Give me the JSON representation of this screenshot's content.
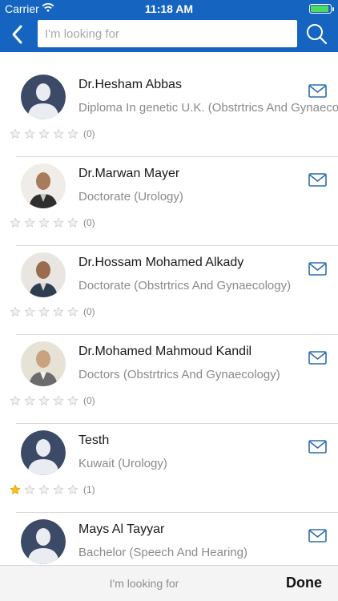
{
  "status_bar": {
    "carrier": "Carrier",
    "time": "11:18 AM"
  },
  "search": {
    "placeholder": "I'm looking for",
    "value": ""
  },
  "colors": {
    "header": "#1565c0",
    "star_filled": "#f6c21c",
    "star_empty": "#cfcfcf",
    "mail": "#2b6cb0"
  },
  "doctors": [
    {
      "name": "Dr.Hesham Abbas",
      "degree": "Diploma In  genetic U.K. (Obstrtrics And Gynaecology)",
      "rating": 0,
      "count": "(0)",
      "avatar": "placeholder"
    },
    {
      "name": "Dr.Marwan Mayer",
      "degree": "Doctorate (Urology)",
      "rating": 0,
      "count": "(0)",
      "avatar": "photo"
    },
    {
      "name": "Dr.Hossam Mohamed Alkady",
      "degree": "Doctorate  (Obstrtrics And Gynaecology)",
      "rating": 0,
      "count": "(0)",
      "avatar": "photo"
    },
    {
      "name": "Dr.Mohamed Mahmoud Kandil",
      "degree": "Doctors  (Obstrtrics And Gynaecology)",
      "rating": 0,
      "count": "(0)",
      "avatar": "photo"
    },
    {
      "name": "Testh",
      "degree": "Kuwait (Urology)",
      "rating": 1,
      "count": "(1)",
      "avatar": "placeholder"
    },
    {
      "name": "Mays Al Tayyar",
      "degree": "Bachelor  (Speech And Hearing)",
      "rating": 0,
      "count": "(0)",
      "avatar": "placeholder"
    }
  ],
  "bottom_bar": {
    "placeholder": "I'm looking for",
    "done": "Done"
  }
}
